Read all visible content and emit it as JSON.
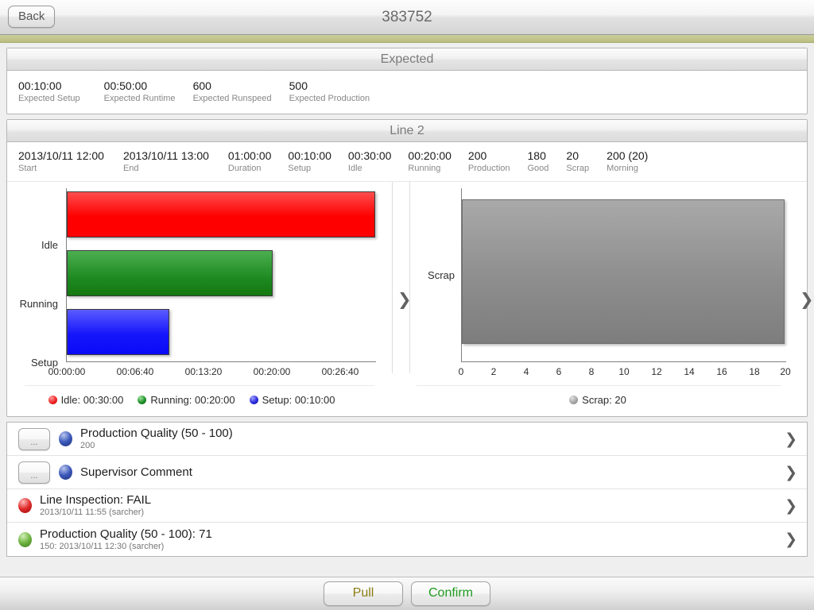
{
  "header": {
    "back_label": "Back",
    "title": "383752"
  },
  "expected": {
    "panel_title": "Expected",
    "stats": [
      {
        "value": "00:10:00",
        "label": "Expected Setup"
      },
      {
        "value": "00:50:00",
        "label": "Expected Runtime"
      },
      {
        "value": "600",
        "label": "Expected Runspeed"
      },
      {
        "value": "500",
        "label": "Expected Production"
      }
    ]
  },
  "line": {
    "panel_title": "Line 2",
    "stats": [
      {
        "value": "2013/10/11 12:00",
        "label": "Start"
      },
      {
        "value": "2013/10/11 13:00",
        "label": "End"
      },
      {
        "value": "01:00:00",
        "label": "Duration"
      },
      {
        "value": "00:10:00",
        "label": "Setup"
      },
      {
        "value": "00:30:00",
        "label": "Idle"
      },
      {
        "value": "00:20:00",
        "label": "Running"
      },
      {
        "value": "200",
        "label": "Production"
      },
      {
        "value": "180",
        "label": "Good"
      },
      {
        "value": "20",
        "label": "Scrap"
      },
      {
        "value": "200 (20)",
        "label": "Morning"
      }
    ],
    "chevron_glyph": "❯"
  },
  "chart_data": [
    {
      "type": "bar",
      "orientation": "horizontal",
      "title": "",
      "xlabel": "",
      "ylabel": "",
      "categories": [
        "Idle",
        "Running",
        "Setup"
      ],
      "values": [
        1800,
        1200,
        600
      ],
      "value_labels": [
        "00:30:00",
        "00:20:00",
        "00:10:00"
      ],
      "colors": [
        "#fe0000",
        "#1f8a22",
        "#1616fb"
      ],
      "xticks": [
        "00:00:00",
        "00:06:40",
        "00:13:20",
        "00:20:00",
        "00:26:40"
      ],
      "xtick_values": [
        0,
        400,
        800,
        1200,
        1600
      ],
      "xlim": [
        0,
        1800
      ],
      "grid": false,
      "legend_position": "bottom",
      "legend": [
        {
          "label": "Idle: 00:30:00",
          "color": "red"
        },
        {
          "label": "Running: 00:20:00",
          "color": "green"
        },
        {
          "label": "Setup: 00:10:00",
          "color": "blue"
        }
      ]
    },
    {
      "type": "bar",
      "orientation": "horizontal",
      "title": "",
      "xlabel": "",
      "ylabel": "",
      "categories": [
        "Scrap"
      ],
      "values": [
        20
      ],
      "value_labels": [
        "20"
      ],
      "colors": [
        "#8e8e8e"
      ],
      "xticks": [
        "0",
        "2",
        "4",
        "6",
        "8",
        "10",
        "12",
        "14",
        "16",
        "18",
        "20"
      ],
      "xtick_values": [
        0,
        2,
        4,
        6,
        8,
        10,
        12,
        14,
        16,
        18,
        20
      ],
      "xlim": [
        0,
        20
      ],
      "grid": false,
      "legend_position": "bottom",
      "legend": [
        {
          "label": "Scrap: 20",
          "color": "gray"
        }
      ]
    }
  ],
  "list": {
    "rows": [
      {
        "has_dots_button": true,
        "dots_label": "...",
        "bullet": "blue",
        "title": "Production Quality (50 - 100)",
        "subtitle": "200",
        "chevron": "❯"
      },
      {
        "has_dots_button": true,
        "dots_label": "...",
        "bullet": "blue",
        "title": "Supervisor Comment",
        "subtitle": "",
        "chevron": "❯"
      },
      {
        "has_dots_button": false,
        "dots_label": "",
        "bullet": "red",
        "title": "Line Inspection: FAIL",
        "subtitle": "2013/10/11 11:55 (sarcher)",
        "chevron": "❯"
      },
      {
        "has_dots_button": false,
        "dots_label": "",
        "bullet": "green",
        "title": "Production Quality (50 - 100): 71",
        "subtitle": "150: 2013/10/11 12:30 (sarcher)",
        "chevron": "❯"
      }
    ]
  },
  "toolbar": {
    "pull_label": "Pull",
    "confirm_label": "Confirm",
    "pull_color": "#8a7b13",
    "confirm_color": "#1f9c1f"
  }
}
